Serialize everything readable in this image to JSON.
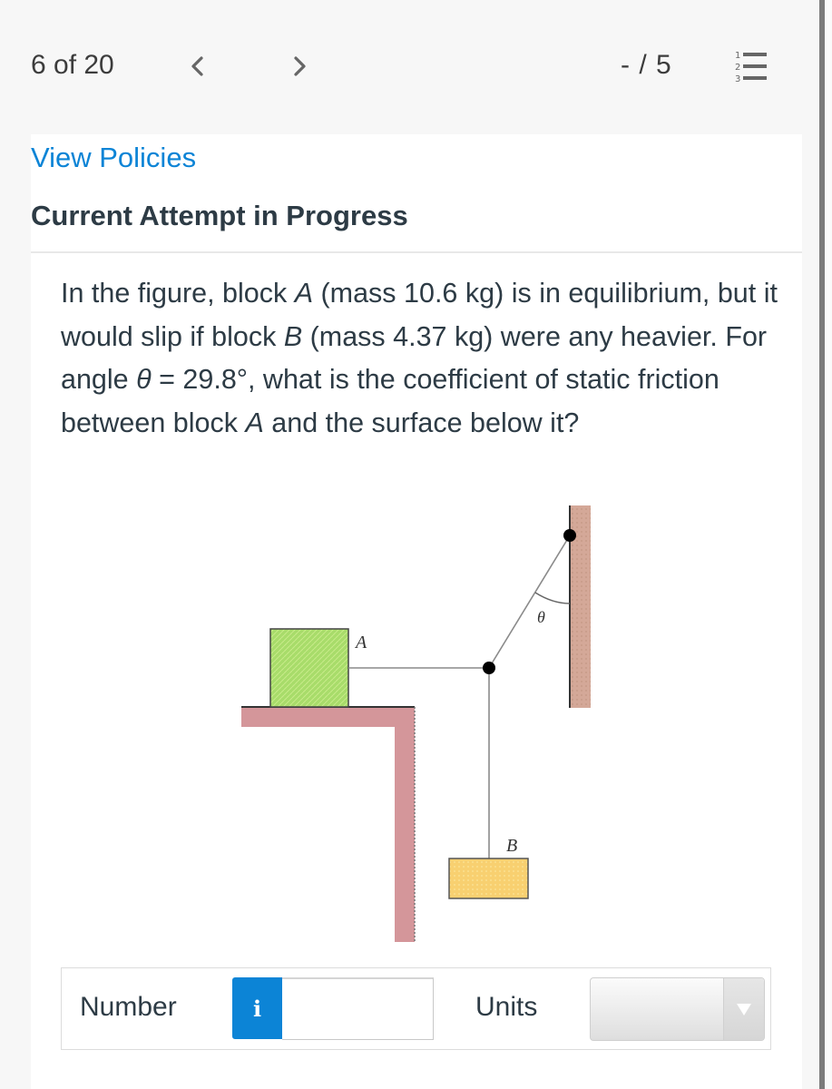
{
  "header": {
    "question_counter": "6 of 20",
    "prev_icon": "chevron-left-icon",
    "next_icon": "chevron-right-icon",
    "score": "- / 5",
    "question_list_icon": "numbered-list-icon",
    "question_list_numbers": [
      "1",
      "2",
      "3"
    ]
  },
  "card": {
    "view_policies_label": "View Policies",
    "attempt_title": "Current Attempt in Progress",
    "question": {
      "part1": "In the figure, block ",
      "blockA": "A",
      "part2": " (mass 10.6 kg) is in equilibrium, but it would slip if block ",
      "blockB": "B",
      "part3": " (mass 4.37 kg) were any heavier. For angle ",
      "theta": "θ",
      "part4": " = 29.8°, what is the coefficient of static friction between block ",
      "blockA2": "A",
      "part5": " and the surface below it?"
    },
    "figure": {
      "label_A": "A",
      "label_B": "B",
      "label_theta": "θ",
      "colors": {
        "block_A": "#a8dc6a",
        "block_B": "#f8d070",
        "shelf": "#d4969a",
        "wall": "#d4a898",
        "rope": "#8a8a8a",
        "knot": "#000000"
      }
    },
    "answer": {
      "number_label": "Number",
      "info_icon": "info-icon",
      "info_glyph": "i",
      "number_value": "",
      "units_label": "Units",
      "units_selected": "",
      "units_icon": "dropdown-arrow-icon"
    }
  },
  "colors": {
    "link": "#0c84d6",
    "info_button": "#0c84d6",
    "text": "#2d3b45",
    "page_bg": "#f7f7f7"
  }
}
